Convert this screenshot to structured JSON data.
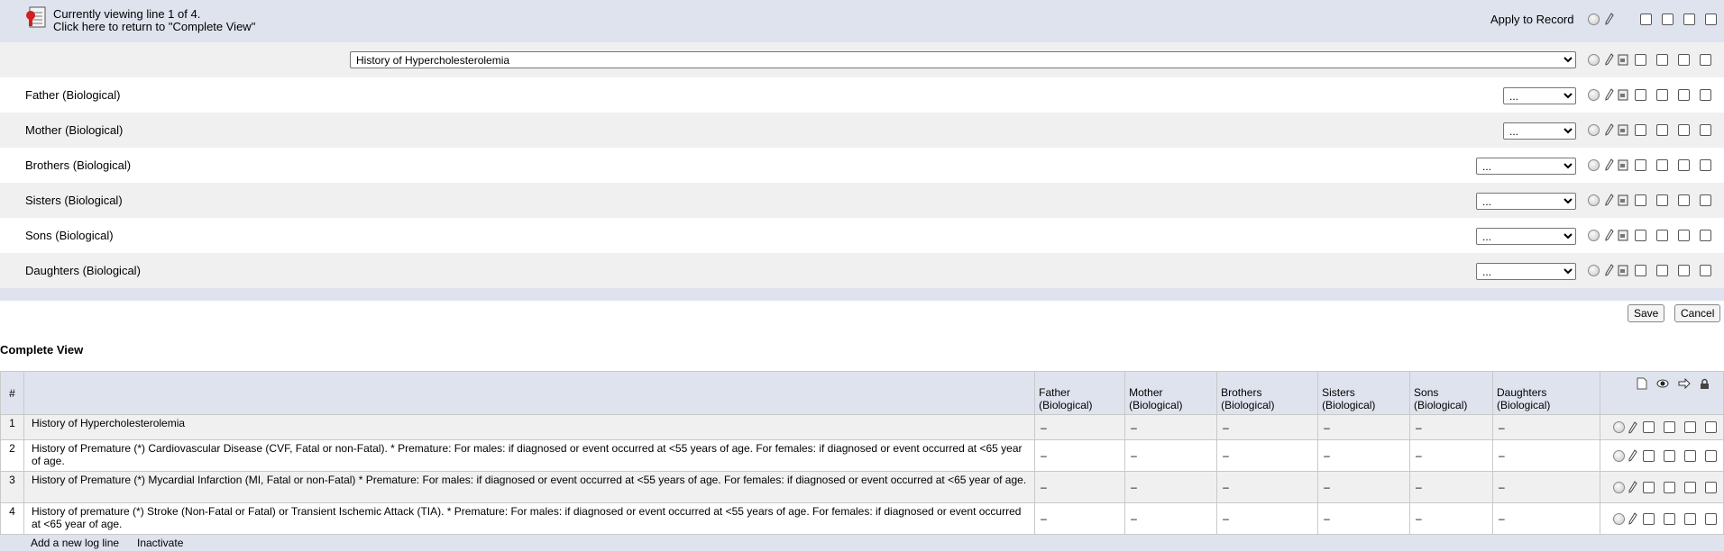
{
  "header": {
    "viewing_line": "Currently viewing line 1 of 4.",
    "return_link": "Click here to return to \"Complete View\"",
    "apply_label": "Apply to Record"
  },
  "editor": {
    "topic_select": "History of Hypercholesterolemia",
    "rows": [
      {
        "label": "Father (Biological)",
        "value": "..."
      },
      {
        "label": "Mother (Biological)",
        "value": "..."
      },
      {
        "label": "Brothers (Biological)",
        "value": "..."
      },
      {
        "label": "Sisters (Biological)",
        "value": "..."
      },
      {
        "label": "Sons (Biological)",
        "value": "..."
      },
      {
        "label": "Daughters (Biological)",
        "value": "..."
      }
    ]
  },
  "buttons": {
    "save": "Save",
    "cancel": "Cancel"
  },
  "complete_view": {
    "title": "Complete View",
    "columns": [
      "#",
      "",
      "Father (Biological)",
      "Mother (Biological)",
      "Brothers (Biological)",
      "Sisters (Biological)",
      "Sons (Biological)",
      "Daughters (Biological)"
    ],
    "rows": [
      {
        "num": "1",
        "text": "History of Hypercholesterolemia",
        "cells": [
          "–",
          "–",
          "–",
          "–",
          "–",
          "–"
        ]
      },
      {
        "num": "2",
        "text": "History of Premature (*) Cardiovascular Disease (CVF, Fatal or non-Fatal). * Premature: For males: if diagnosed or event occurred at <55 years of age. For females: if diagnosed or event occurred at <65 year of age.",
        "cells": [
          "–",
          "–",
          "–",
          "–",
          "–",
          "–"
        ]
      },
      {
        "num": "3",
        "text": "History of Premature (*) Mycardial Infarction (MI, Fatal or non-Fatal) * Premature: For males: if diagnosed or event occurred at <55 years of age. For females: if diagnosed or event occurred at <65 year of age.",
        "cells": [
          "–",
          "–",
          "–",
          "–",
          "–",
          "–"
        ]
      },
      {
        "num": "4",
        "text": "History of premature (*) Stroke (Non-Fatal or Fatal) or Transient Ischemic Attack (TIA). * Premature: For males: if diagnosed or event occurred at <55 years of age. For females: if diagnosed or event occurred at <65 year of age.",
        "cells": [
          "–",
          "–",
          "–",
          "–",
          "–",
          "–"
        ]
      }
    ]
  },
  "footer": {
    "add_line": "Add a new log line",
    "inactivate": "Inactivate"
  },
  "colors": {
    "band_blue": "#dfe3ee",
    "band_grey": "#f0f0f0"
  }
}
